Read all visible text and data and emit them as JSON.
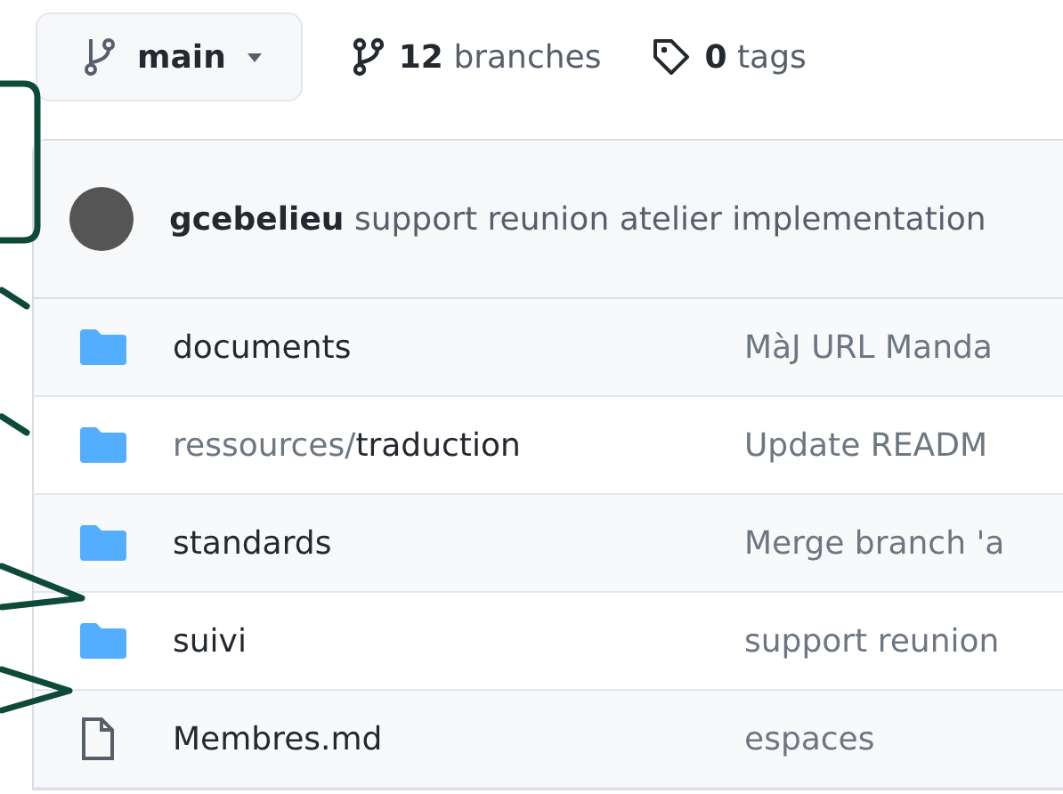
{
  "branch_selector": {
    "label": "main"
  },
  "branch_count": {
    "count": "12",
    "label": "branches"
  },
  "tag_count": {
    "count": "0",
    "label": "tags"
  },
  "latest_commit": {
    "author": "gcebelieu",
    "message": "support reunion atelier implementation"
  },
  "files": [
    {
      "kind": "folder",
      "name": "documents",
      "message": "MàJ URL Manda"
    },
    {
      "kind": "folder",
      "name": "ressources/**traduction**",
      "message": "Update READM"
    },
    {
      "kind": "folder",
      "name": "standards",
      "message": "Merge branch 'a"
    },
    {
      "kind": "folder",
      "name": "suivi",
      "message": "support reunion"
    },
    {
      "kind": "file",
      "name": "Membres.md",
      "message": "espaces"
    }
  ]
}
